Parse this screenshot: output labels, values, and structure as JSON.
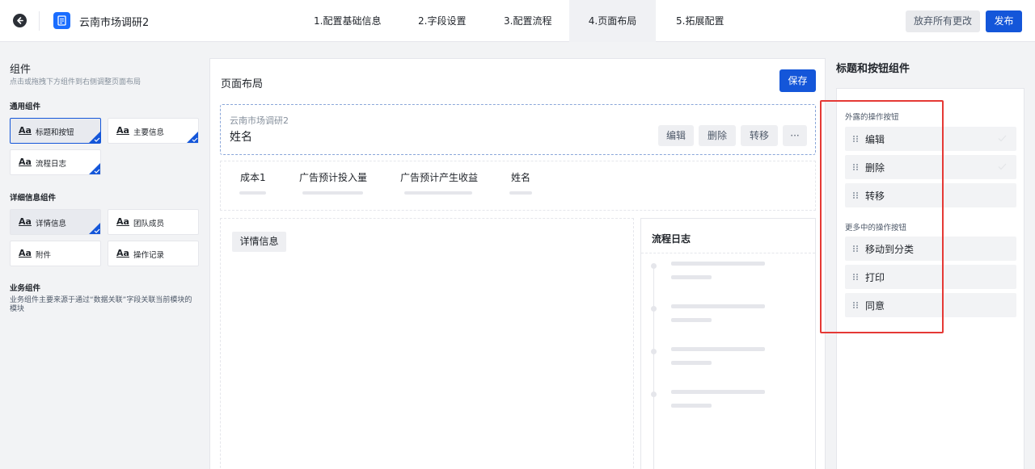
{
  "topbar": {
    "app_title": "云南市场调研2",
    "steps": [
      {
        "label": "1.配置基础信息"
      },
      {
        "label": "2.字段设置"
      },
      {
        "label": "3.配置流程"
      },
      {
        "label": "4.页面布局"
      },
      {
        "label": "5.拓展配置"
      }
    ],
    "active_step": "4.页面布局",
    "discard_label": "放弃所有更改",
    "publish_label": "发布"
  },
  "left": {
    "title": "组件",
    "subtitle": "点击或拖拽下方组件到右侧调整页面布局",
    "general_title": "通用组件",
    "general_items": [
      {
        "aa": "Aa",
        "label": "标题和按钮"
      },
      {
        "aa": "Aa",
        "label": "主要信息"
      },
      {
        "aa": "Aa",
        "label": "流程日志"
      }
    ],
    "detail_title": "详细信息组件",
    "detail_items": [
      {
        "aa": "Aa",
        "label": "详情信息"
      },
      {
        "aa": "Aa",
        "label": "团队成员"
      },
      {
        "aa": "Aa",
        "label": "附件"
      },
      {
        "aa": "Aa",
        "label": "操作记录"
      }
    ],
    "business_title": "业务组件",
    "business_desc": "业务组件主要来源于通过“数据关联”字段关联当前模块的模块"
  },
  "center": {
    "title": "页面布局",
    "save_label": "保存",
    "header": {
      "app_name": "云南市场调研2",
      "record_name": "姓名",
      "buttons": [
        "编辑",
        "删除",
        "转移",
        "···"
      ]
    },
    "main_info": {
      "fields": [
        "成本1",
        "广告预计投入量",
        "广告预计产生收益",
        "姓名"
      ]
    },
    "detail_tab": "详情信息",
    "log_title": "流程日志"
  },
  "right": {
    "title": "标题和按钮组件",
    "exposed_label": "外露的操作按钮",
    "exposed_buttons": [
      "编辑",
      "删除",
      "转移"
    ],
    "more_label": "更多中的操作按钮",
    "more_buttons": [
      "移动到分类",
      "打印",
      "同意"
    ]
  },
  "colors": {
    "primary": "#1456d9",
    "app_icon": "#1a6dff",
    "highlight": "#e53935"
  }
}
